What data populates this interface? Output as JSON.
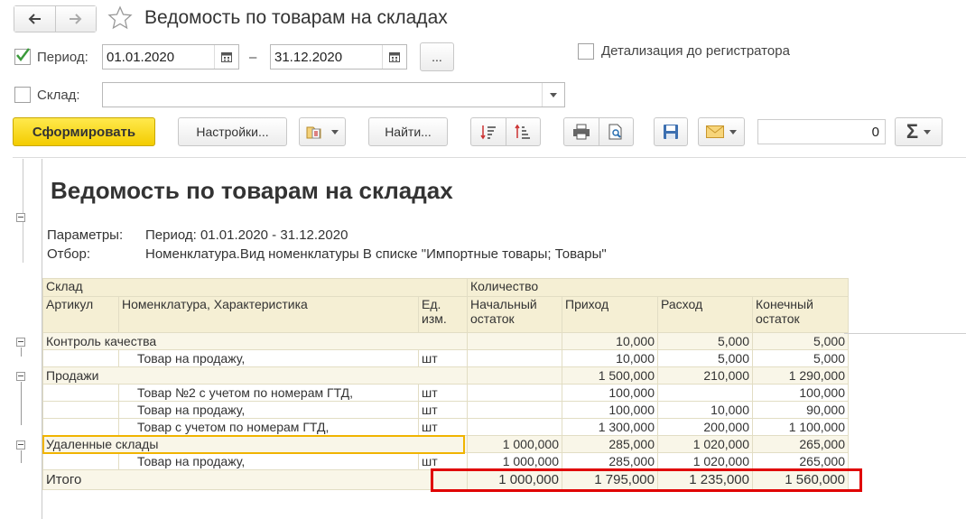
{
  "window": {
    "title": "Ведомость по товарам на складах"
  },
  "form": {
    "period_label": "Период:",
    "period_from": "01.01.2020",
    "dash": "–",
    "period_to": "31.12.2020",
    "dots_label": "...",
    "detail_label": "Детализация до регистратора",
    "warehouse_label": "Склад:",
    "warehouse_value": ""
  },
  "toolbar": {
    "generate": "Сформировать",
    "settings": "Настройки...",
    "find": "Найти...",
    "sum_value": "0",
    "sigma": "Σ"
  },
  "report": {
    "title": "Ведомость по товарам на складах",
    "params_label": "Параметры:",
    "params_value": "Период: 01.01.2020 - 31.12.2020",
    "filter_label": "Отбор:",
    "filter_value": "Номенклатура.Вид номенклатуры В списке \"Импортные товары; Товары\"",
    "headers": {
      "warehouse": "Склад",
      "quantity": "Количество",
      "article": "Артикул",
      "nomenclature": "Номенклатура, Характеристика",
      "unit1": "Ед.",
      "unit2": "изм.",
      "start1": "Начальный",
      "start2": "остаток",
      "income": "Приход",
      "expense": "Расход",
      "end1": "Конечный",
      "end2": "остаток"
    },
    "rows": [
      {
        "type": "group",
        "name": "Контроль качества",
        "unit": "",
        "start": "",
        "income": "10,000",
        "expense": "5,000",
        "end": "5,000"
      },
      {
        "type": "item",
        "name": "Товар на продажу,",
        "unit": "шт",
        "start": "",
        "income": "10,000",
        "expense": "5,000",
        "end": "5,000"
      },
      {
        "type": "group",
        "name": "Продажи",
        "unit": "",
        "start": "",
        "income": "1 500,000",
        "expense": "210,000",
        "end": "1 290,000"
      },
      {
        "type": "item",
        "name": "Товар №2 с учетом по номерам ГТД,",
        "unit": "шт",
        "start": "",
        "income": "100,000",
        "expense": "",
        "end": "100,000"
      },
      {
        "type": "item",
        "name": "Товар на продажу,",
        "unit": "шт",
        "start": "",
        "income": "100,000",
        "expense": "10,000",
        "end": "90,000"
      },
      {
        "type": "item",
        "name": "Товар с учетом по номерам ГТД,",
        "unit": "шт",
        "start": "",
        "income": "1 300,000",
        "expense": "200,000",
        "end": "1 100,000"
      },
      {
        "type": "group",
        "name": "Удаленные склады",
        "unit": "",
        "start": "1 000,000",
        "income": "285,000",
        "expense": "1 020,000",
        "end": "265,000"
      },
      {
        "type": "item",
        "name": "Товар на продажу,",
        "unit": "шт",
        "start": "1 000,000",
        "income": "285,000",
        "expense": "1 020,000",
        "end": "265,000"
      }
    ],
    "total": {
      "label": "Итого",
      "start": "1 000,000",
      "income": "1 795,000",
      "expense": "1 235,000",
      "end": "1 560,000"
    }
  }
}
